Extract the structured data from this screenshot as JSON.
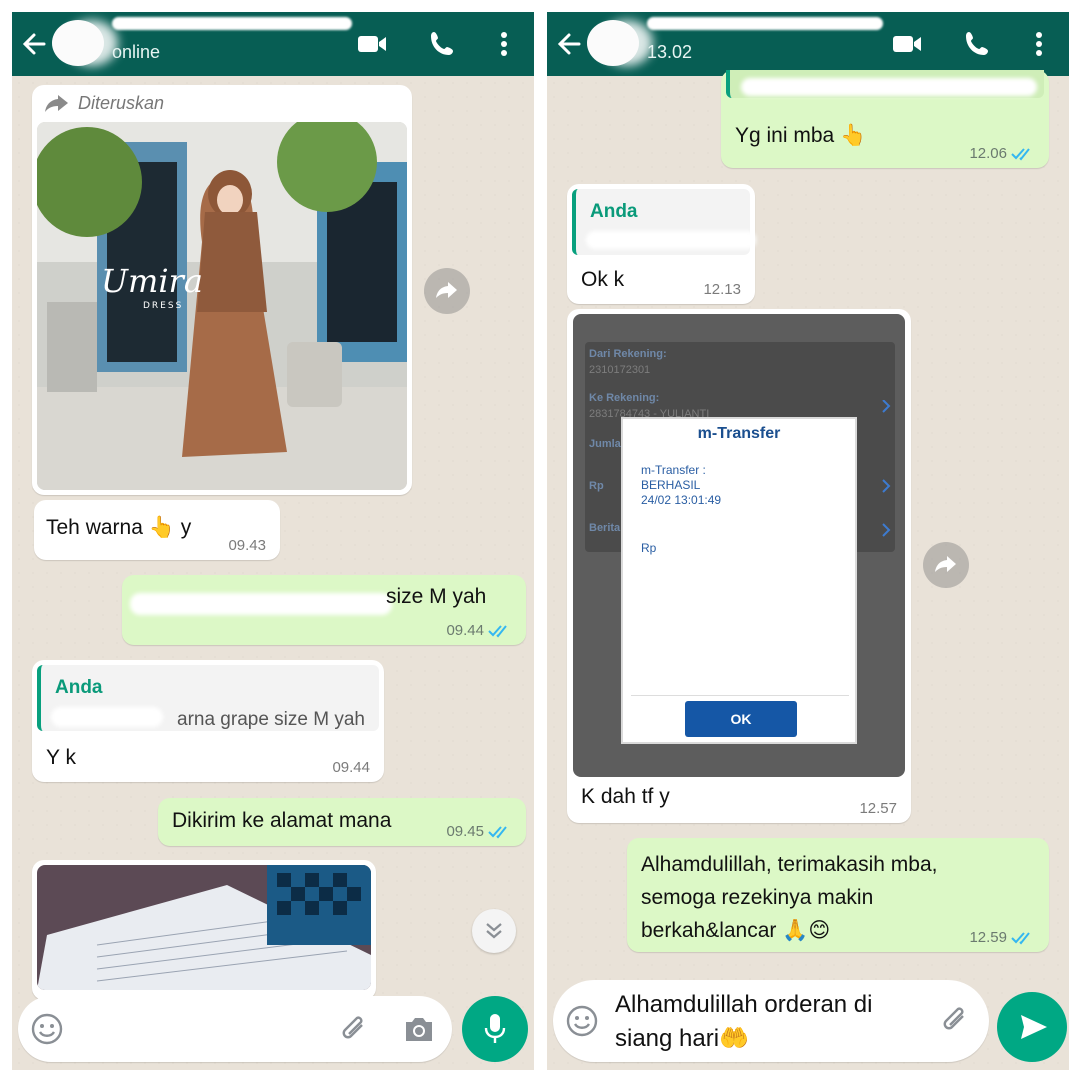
{
  "left": {
    "header": {
      "status": "online"
    },
    "messages": {
      "forwarded_label": "Diteruskan",
      "photo_caption_text": "Teh warna 👆 y",
      "photo_caption_time": "09.43",
      "order_text": "size M yah",
      "order_time": "09.44",
      "reply_quote_name": "Anda",
      "reply_quote_text": "arna grape size M yah",
      "reply_text": "Y k",
      "reply_time": "09.44",
      "address_text": "Dikirim ke alamat mana",
      "address_time": "09.45",
      "brand_logo": "Umira",
      "brand_sub": "DRESS"
    }
  },
  "right": {
    "header": {
      "status": "13.02"
    },
    "messages": {
      "this_one_text": "Yg ini mba 👆",
      "this_one_time": "12.06",
      "reply_quote_name": "Anda",
      "ok_text": "Ok k",
      "ok_time": "12.13",
      "transfer_caption": "K dah tf y",
      "transfer_time": "12.57",
      "thanks_text_1": "Alhamdulillah, terimakasih mba,",
      "thanks_text_2": "semoga rezekinya makin",
      "thanks_text_3": "berkah&lancar 🙏😊",
      "thanks_time": "12.59"
    },
    "receipt": {
      "row1_label": "Dari Rekening:",
      "row1_value": "2310172301",
      "row2_label": "Ke Rekening:",
      "row2_value": "2831784743 - YULIANTI",
      "row3_label": "Jumla",
      "row4_label": "Rp",
      "row5_label": "Berita",
      "dialog_title": "m-Transfer",
      "dialog_line1": "m-Transfer :",
      "dialog_line2": "BERHASIL",
      "dialog_line3": "24/02 13:01:49",
      "dialog_line4": "Rp",
      "ok_button": "OK"
    },
    "composer": {
      "draft_line1": "Alhamdulillah orderan di",
      "draft_line2": "siang hari🤲"
    }
  }
}
